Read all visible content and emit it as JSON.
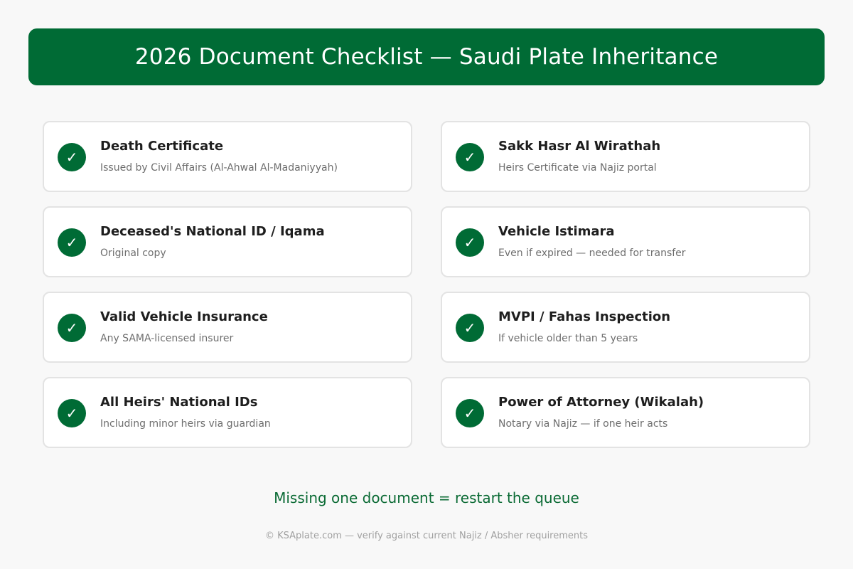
{
  "header": {
    "title": "2026 Document Checklist — Saudi Plate Inheritance"
  },
  "check_icon": "check-mark-icon",
  "colors": {
    "accent": "#006b35",
    "background": "#f8f8f8",
    "card_border": "#e3e3e3"
  },
  "items": [
    {
      "title": "Death Certificate",
      "subtitle": "Issued by Civil Affairs (Al-Ahwal Al-Madaniyyah)",
      "checked": true
    },
    {
      "title": "Sakk Hasr Al Wirathah",
      "subtitle": "Heirs Certificate via Najiz portal",
      "checked": true
    },
    {
      "title": "Deceased's National ID / Iqama",
      "subtitle": "Original copy",
      "checked": true
    },
    {
      "title": "Vehicle Istimara",
      "subtitle": "Even if expired — needed for transfer",
      "checked": true
    },
    {
      "title": "Valid Vehicle Insurance",
      "subtitle": "Any SAMA-licensed insurer",
      "checked": true
    },
    {
      "title": "MVPI / Fahas Inspection",
      "subtitle": "If vehicle older than 5 years",
      "checked": true
    },
    {
      "title": "All Heirs' National IDs",
      "subtitle": "Including minor heirs via guardian",
      "checked": true
    },
    {
      "title": "Power of Attorney (Wikalah)",
      "subtitle": "Notary via Najiz — if one heir acts",
      "checked": true
    }
  ],
  "note": "Missing one document = restart the queue",
  "footer": "© KSAplate.com — verify against current Najiz / Absher requirements"
}
